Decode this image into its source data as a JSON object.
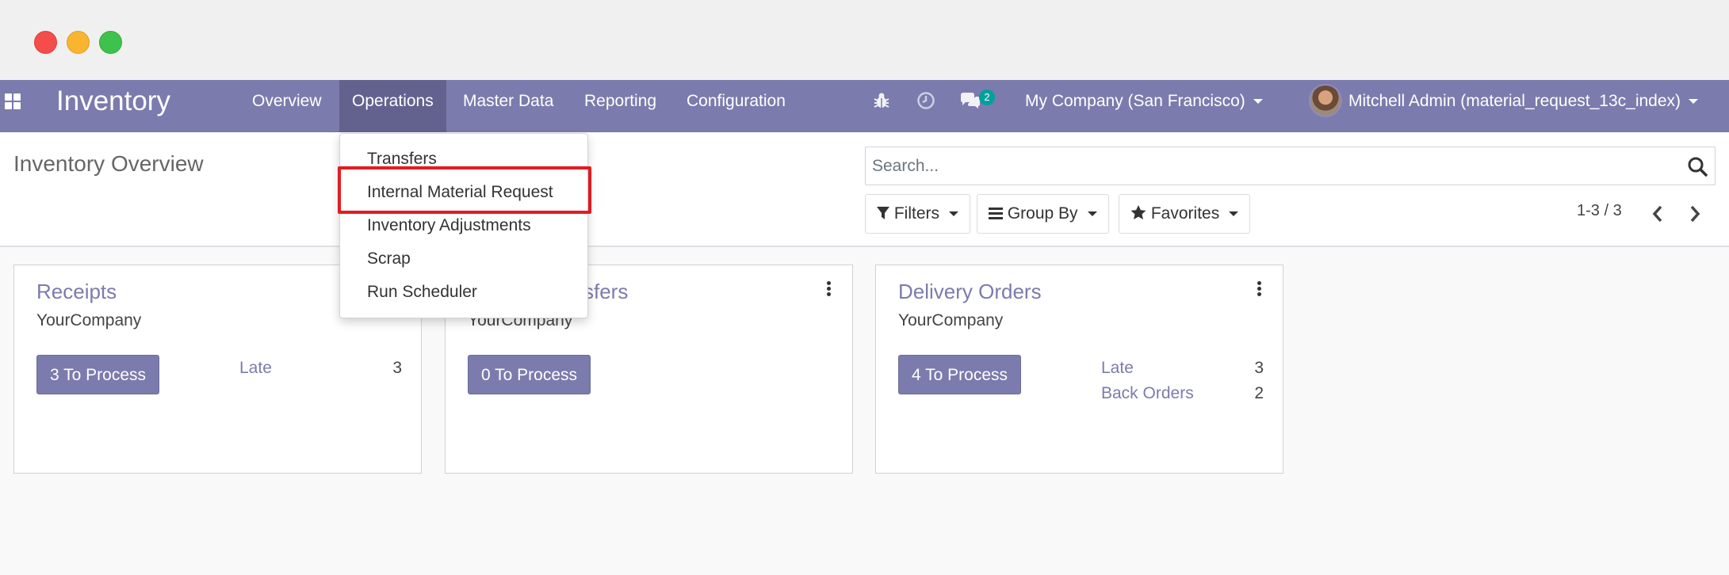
{
  "window": {
    "controls": [
      "close",
      "minimize",
      "maximize"
    ],
    "colors": {
      "close": "#f54d4a",
      "minimize": "#f9b52f",
      "maximize": "#3fc24d"
    }
  },
  "navbar": {
    "apps_icon": "apps-grid-icon",
    "brand": "Inventory",
    "menu": [
      {
        "label": "Overview"
      },
      {
        "label": "Operations",
        "active": true
      },
      {
        "label": "Master Data"
      },
      {
        "label": "Reporting"
      },
      {
        "label": "Configuration"
      }
    ],
    "icons": [
      "bug-icon",
      "clock-icon",
      "chat-icon"
    ],
    "messages_badge": "2",
    "company": "My Company (San Francisco)",
    "user": "Mitchell Admin (material_request_13c_index)",
    "color": "#7c7bad"
  },
  "dropdown": {
    "items": [
      {
        "label": "Transfers"
      },
      {
        "label": "Internal Material Request",
        "highlighted": true
      },
      {
        "label": "Inventory Adjustments"
      },
      {
        "label": "Scrap"
      },
      {
        "label": "Run Scheduler"
      }
    ],
    "highlight_color": "#e31b23"
  },
  "control_panel": {
    "title": "Inventory Overview",
    "search_placeholder": "Search...",
    "filters_label": "Filters",
    "groupby_label": "Group By",
    "favorites_label": "Favorites",
    "pager": "1-3 / 3"
  },
  "cards": [
    {
      "title": "Receipts",
      "company": "YourCompany",
      "button": "3 To Process",
      "stats": [
        {
          "label": "Late",
          "value": "3"
        }
      ]
    },
    {
      "title": "Internal Transfers",
      "company": "YourCompany",
      "button": "0 To Process",
      "stats": []
    },
    {
      "title": "Delivery Orders",
      "company": "YourCompany",
      "button": "4 To Process",
      "stats": [
        {
          "label": "Late",
          "value": "3"
        },
        {
          "label": "Back Orders",
          "value": "2"
        }
      ]
    }
  ]
}
